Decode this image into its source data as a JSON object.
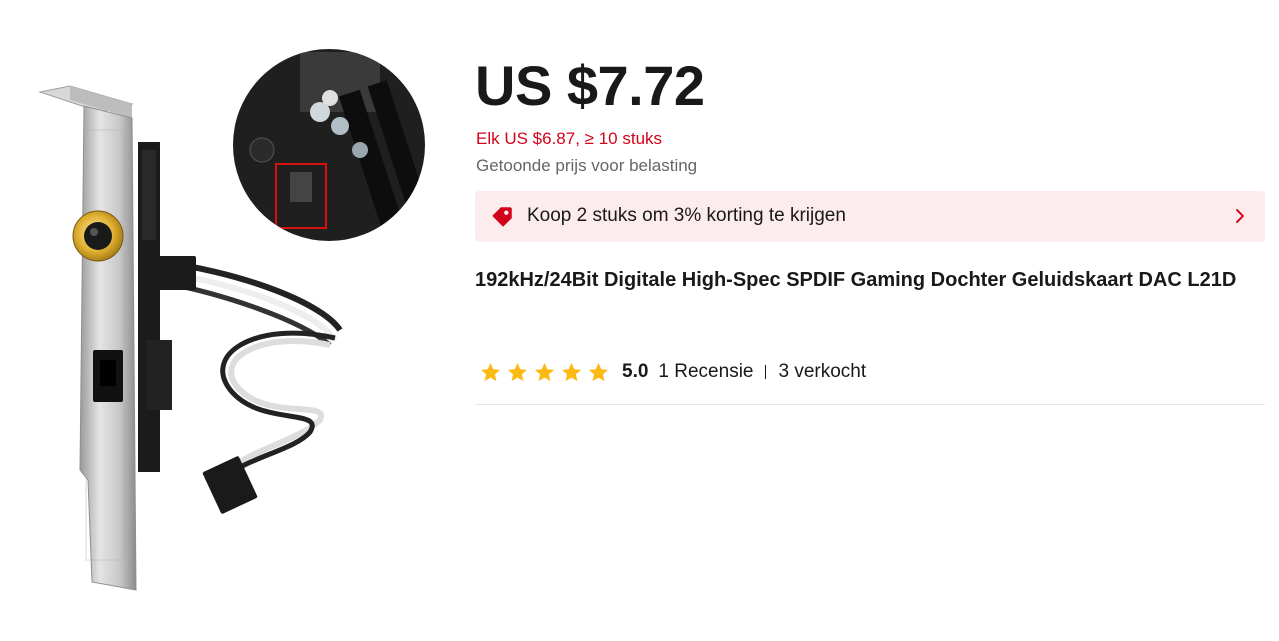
{
  "product": {
    "price": "US $7.72",
    "tier_price": "Elk US $6.87, ≥ 10 stuks",
    "tax_note": "Getoonde prijs voor belasting",
    "promo": {
      "text": "Koop 2 stuks om 3% korting te krijgen",
      "icon": "tag-icon",
      "chevron": "chevron-right-icon"
    },
    "title": "192kHz/24Bit Digitale High-Spec SPDIF Gaming Dochter Geluidskaart DAC L21D",
    "rating": {
      "stars": 5,
      "score": "5.0",
      "reviews": "1 Recensie",
      "sold": "3 verkocht"
    }
  },
  "colors": {
    "accent_red": "#d3031c",
    "promo_bg": "#fdeced",
    "star": "#fdb913",
    "muted": "#666666"
  }
}
